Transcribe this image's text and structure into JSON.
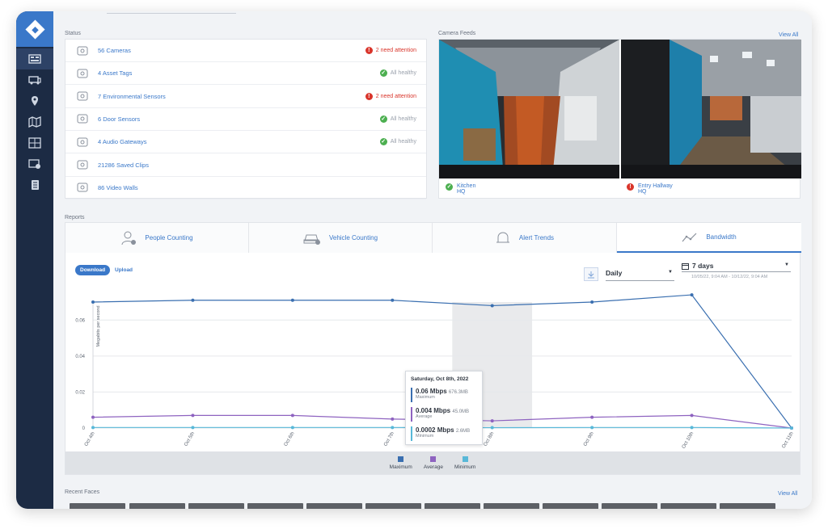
{
  "sidebar": {
    "items": [
      {
        "icon": "dashboard-icon",
        "active": true
      },
      {
        "icon": "vehicle-icon"
      },
      {
        "icon": "location-pin-icon"
      },
      {
        "icon": "map-icon"
      },
      {
        "icon": "video-wall-icon"
      },
      {
        "icon": "camera-settings-icon"
      },
      {
        "icon": "document-icon"
      }
    ]
  },
  "status": {
    "title": "Status",
    "rows": [
      {
        "label": "56 Cameras",
        "status": "2 need attention",
        "state": "attention",
        "icon": "camera-icon"
      },
      {
        "label": "4 Asset Tags",
        "status": "All healthy",
        "state": "healthy",
        "icon": "asset-tag-icon"
      },
      {
        "label": "7 Environmental Sensors",
        "status": "2 need attention",
        "state": "attention",
        "icon": "environmental-sensor-icon"
      },
      {
        "label": "6 Door Sensors",
        "status": "All healthy",
        "state": "healthy",
        "icon": "door-sensor-icon"
      },
      {
        "label": "4 Audio Gateways",
        "status": "All healthy",
        "state": "healthy",
        "icon": "microphone-icon"
      },
      {
        "label": "21286 Saved Clips",
        "status": "",
        "state": "none",
        "icon": "saved-clips-icon"
      },
      {
        "label": "86 Video Walls",
        "status": "",
        "state": "none",
        "icon": "video-wall-icon"
      }
    ]
  },
  "feeds": {
    "title": "Camera Feeds",
    "view_all": "View All",
    "items": [
      {
        "name": "Kitchen",
        "site": "HQ",
        "state": "healthy"
      },
      {
        "name": "Entry Hallway",
        "site": "HQ",
        "state": "attention"
      }
    ]
  },
  "reports": {
    "title": "Reports",
    "tabs": [
      {
        "label": "People Counting",
        "icon": "person-icon"
      },
      {
        "label": "Vehicle Counting",
        "icon": "car-icon"
      },
      {
        "label": "Alert Trends",
        "icon": "bell-icon"
      },
      {
        "label": "Bandwidth",
        "icon": "trend-line-icon",
        "active": true
      }
    ],
    "download_label": "Download",
    "upload_label": "Upload",
    "interval": "Daily",
    "range_label": "7 days",
    "range_dates": "10/05/22, 9:04 AM - 10/12/22, 9:04 AM",
    "tooltip": {
      "date": "Saturday, Oct 8th, 2022",
      "rows": [
        {
          "value": "0.06 Mbps",
          "total": "676.3MB",
          "name": "Maximum",
          "color": "#3a6fb0"
        },
        {
          "value": "0.004 Mbps",
          "total": "45.0MB",
          "name": "Average",
          "color": "#8e63c0"
        },
        {
          "value": "0.0002 Mbps",
          "total": "2.6MB",
          "name": "Minimum",
          "color": "#58b8d8"
        }
      ]
    }
  },
  "chart_data": {
    "type": "line",
    "ylabel": "Megabits per second",
    "ylim": [
      0,
      0.07
    ],
    "yticks": [
      "0",
      "0.02",
      "0.04",
      "0.06"
    ],
    "categories": [
      "Oct 4th",
      "Oct 5th",
      "Oct 6th",
      "Oct 7th",
      "Oct 8th",
      "Oct 9th",
      "Oct 10th",
      "Oct 11th"
    ],
    "series": [
      {
        "name": "Maximum",
        "color": "#3a6fb0",
        "values": [
          0.07,
          0.071,
          0.071,
          0.071,
          0.068,
          0.07,
          0.074,
          0.0
        ]
      },
      {
        "name": "Average",
        "color": "#8e63c0",
        "values": [
          0.006,
          0.007,
          0.007,
          0.005,
          0.004,
          0.006,
          0.007,
          0.0
        ]
      },
      {
        "name": "Minimum",
        "color": "#58b8d8",
        "values": [
          0.0003,
          0.0003,
          0.0003,
          0.0003,
          0.0002,
          0.0003,
          0.0003,
          0.0
        ]
      }
    ],
    "highlight_category": "Oct 8th"
  },
  "recent_faces": {
    "title": "Recent Faces",
    "view_all": "View All"
  }
}
